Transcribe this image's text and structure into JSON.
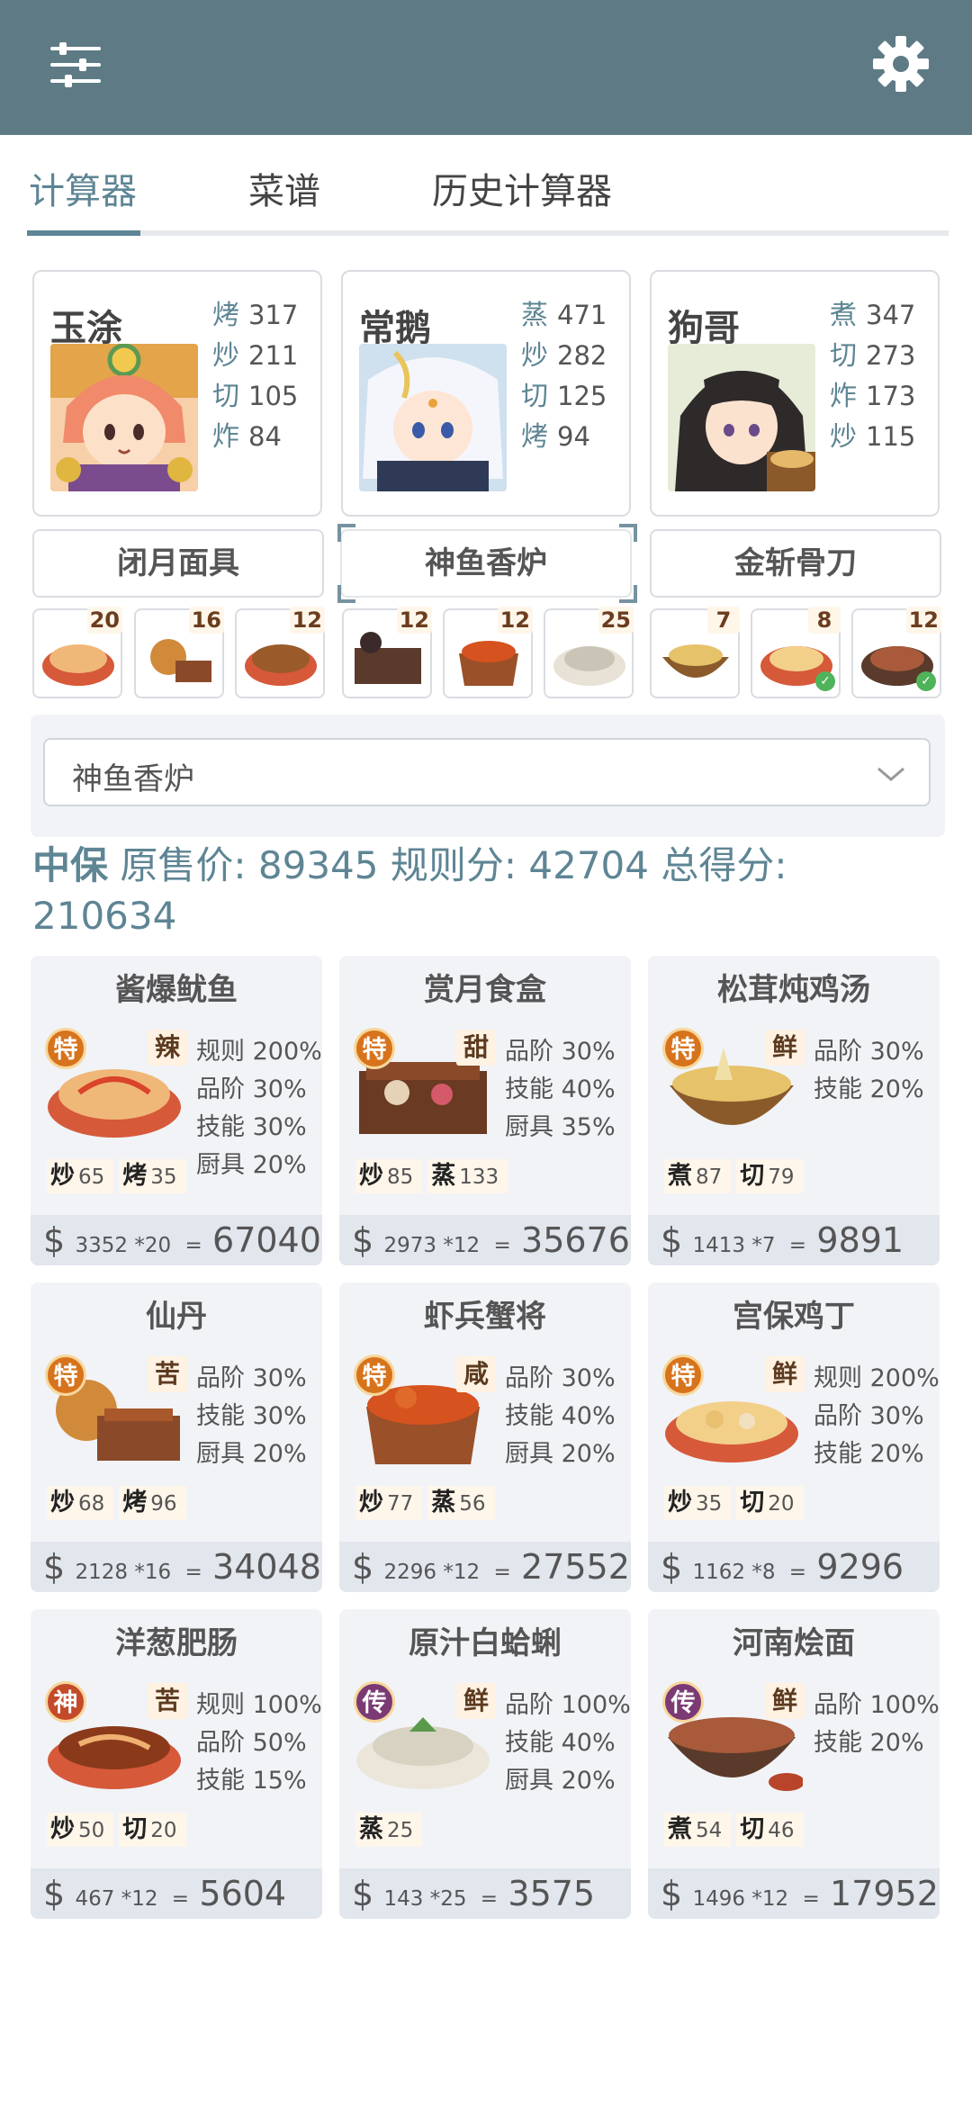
{
  "header": {
    "menu_icon": "sliders-icon",
    "settings_icon": "gear-icon",
    "bg_color": "#5e7b85"
  },
  "tabs": [
    {
      "label": "计算器",
      "active": true
    },
    {
      "label": "菜谱",
      "active": false
    },
    {
      "label": "历史计算器",
      "active": false
    }
  ],
  "chefs": [
    {
      "name": "玉涂",
      "stats": [
        {
          "k": "烤",
          "v": "317"
        },
        {
          "k": "炒",
          "v": "211"
        },
        {
          "k": "切",
          "v": "105"
        },
        {
          "k": "炸",
          "v": "84"
        }
      ]
    },
    {
      "name": "常鹅",
      "stats": [
        {
          "k": "蒸",
          "v": "471"
        },
        {
          "k": "炒",
          "v": "282"
        },
        {
          "k": "切",
          "v": "125"
        },
        {
          "k": "烤",
          "v": "94"
        }
      ]
    },
    {
      "name": "狗哥",
      "stats": [
        {
          "k": "煮",
          "v": "347"
        },
        {
          "k": "切",
          "v": "273"
        },
        {
          "k": "炸",
          "v": "173"
        },
        {
          "k": "炒",
          "v": "115"
        }
      ]
    }
  ],
  "equipment": [
    "闭月面具",
    "神鱼香炉",
    "金斩骨刀"
  ],
  "dish_slots": [
    "20",
    "16",
    "12",
    "12",
    "12",
    "25",
    "7",
    "8",
    "12"
  ],
  "selector": {
    "value": "神鱼香炉"
  },
  "summary": {
    "grade": "中保",
    "orig_label": "原售价:",
    "orig_value": "89345",
    "rule_label": "规则分:",
    "rule_value": "42704",
    "total_label": "总得分:",
    "total_value": "210634"
  },
  "dishes": [
    {
      "title": "酱爆鱿鱼",
      "rarity": "特",
      "flavor": "辣",
      "buffs": [
        "规则 200%",
        "品阶 30%",
        "技能 30%",
        "厨具 20%"
      ],
      "skills": [
        {
          "k": "炒",
          "v": "65"
        },
        {
          "k": "烤",
          "v": "35"
        }
      ],
      "price": "3352 *20",
      "eq": "=",
      "total": "67040"
    },
    {
      "title": "赏月食盒",
      "rarity": "特",
      "flavor": "甜",
      "buffs": [
        "品阶 30%",
        "技能 40%",
        "厨具 35%"
      ],
      "skills": [
        {
          "k": "炒",
          "v": "85"
        },
        {
          "k": "蒸",
          "v": "133"
        }
      ],
      "price": "2973 *12",
      "eq": "=",
      "total": "35676"
    },
    {
      "title": "松茸炖鸡汤",
      "rarity": "特",
      "flavor": "鲜",
      "buffs": [
        "品阶 30%",
        "技能 20%"
      ],
      "skills": [
        {
          "k": "煮",
          "v": "87"
        },
        {
          "k": "切",
          "v": "79"
        }
      ],
      "price": "1413 *7",
      "eq": "=",
      "total": "9891"
    },
    {
      "title": "仙丹",
      "rarity": "特",
      "flavor": "苦",
      "buffs": [
        "品阶 30%",
        "技能 30%",
        "厨具 20%"
      ],
      "skills": [
        {
          "k": "炒",
          "v": "68"
        },
        {
          "k": "烤",
          "v": "96"
        }
      ],
      "price": "2128 *16",
      "eq": "=",
      "total": "34048"
    },
    {
      "title": "虾兵蟹将",
      "rarity": "特",
      "flavor": "咸",
      "buffs": [
        "品阶 30%",
        "技能 40%",
        "厨具 20%"
      ],
      "skills": [
        {
          "k": "炒",
          "v": "77"
        },
        {
          "k": "蒸",
          "v": "56"
        }
      ],
      "price": "2296 *12",
      "eq": "=",
      "total": "27552"
    },
    {
      "title": "宫保鸡丁",
      "rarity": "特",
      "flavor": "鲜",
      "buffs": [
        "规则 200%",
        "品阶 30%",
        "技能 20%"
      ],
      "skills": [
        {
          "k": "炒",
          "v": "35"
        },
        {
          "k": "切",
          "v": "20"
        }
      ],
      "price": "1162 *8",
      "eq": "=",
      "total": "9296"
    },
    {
      "title": "洋葱肥肠",
      "rarity": "神",
      "flavor": "苦",
      "buffs": [
        "规则 100%",
        "品阶 50%",
        "技能 15%"
      ],
      "skills": [
        {
          "k": "炒",
          "v": "50"
        },
        {
          "k": "切",
          "v": "20"
        }
      ],
      "price": "467 *12",
      "eq": "=",
      "total": "5604"
    },
    {
      "title": "原汁白蛤蜊",
      "rarity": "传",
      "flavor": "鲜",
      "buffs": [
        "品阶 100%",
        "技能 40%",
        "厨具 20%"
      ],
      "skills": [
        {
          "k": "蒸",
          "v": "25"
        }
      ],
      "price": "143 *25",
      "eq": "=",
      "total": "3575"
    },
    {
      "title": "河南烩面",
      "rarity": "传",
      "flavor": "鲜",
      "buffs": [
        "品阶 100%",
        "技能 20%"
      ],
      "skills": [
        {
          "k": "煮",
          "v": "54"
        },
        {
          "k": "切",
          "v": "46"
        }
      ],
      "price": "1496 *12",
      "eq": "=",
      "total": "17952"
    }
  ],
  "rarity_colors": {
    "特": "#d7731c",
    "神": "#c44a2a",
    "传": "#7b3a73"
  },
  "currency_symbol": "$"
}
